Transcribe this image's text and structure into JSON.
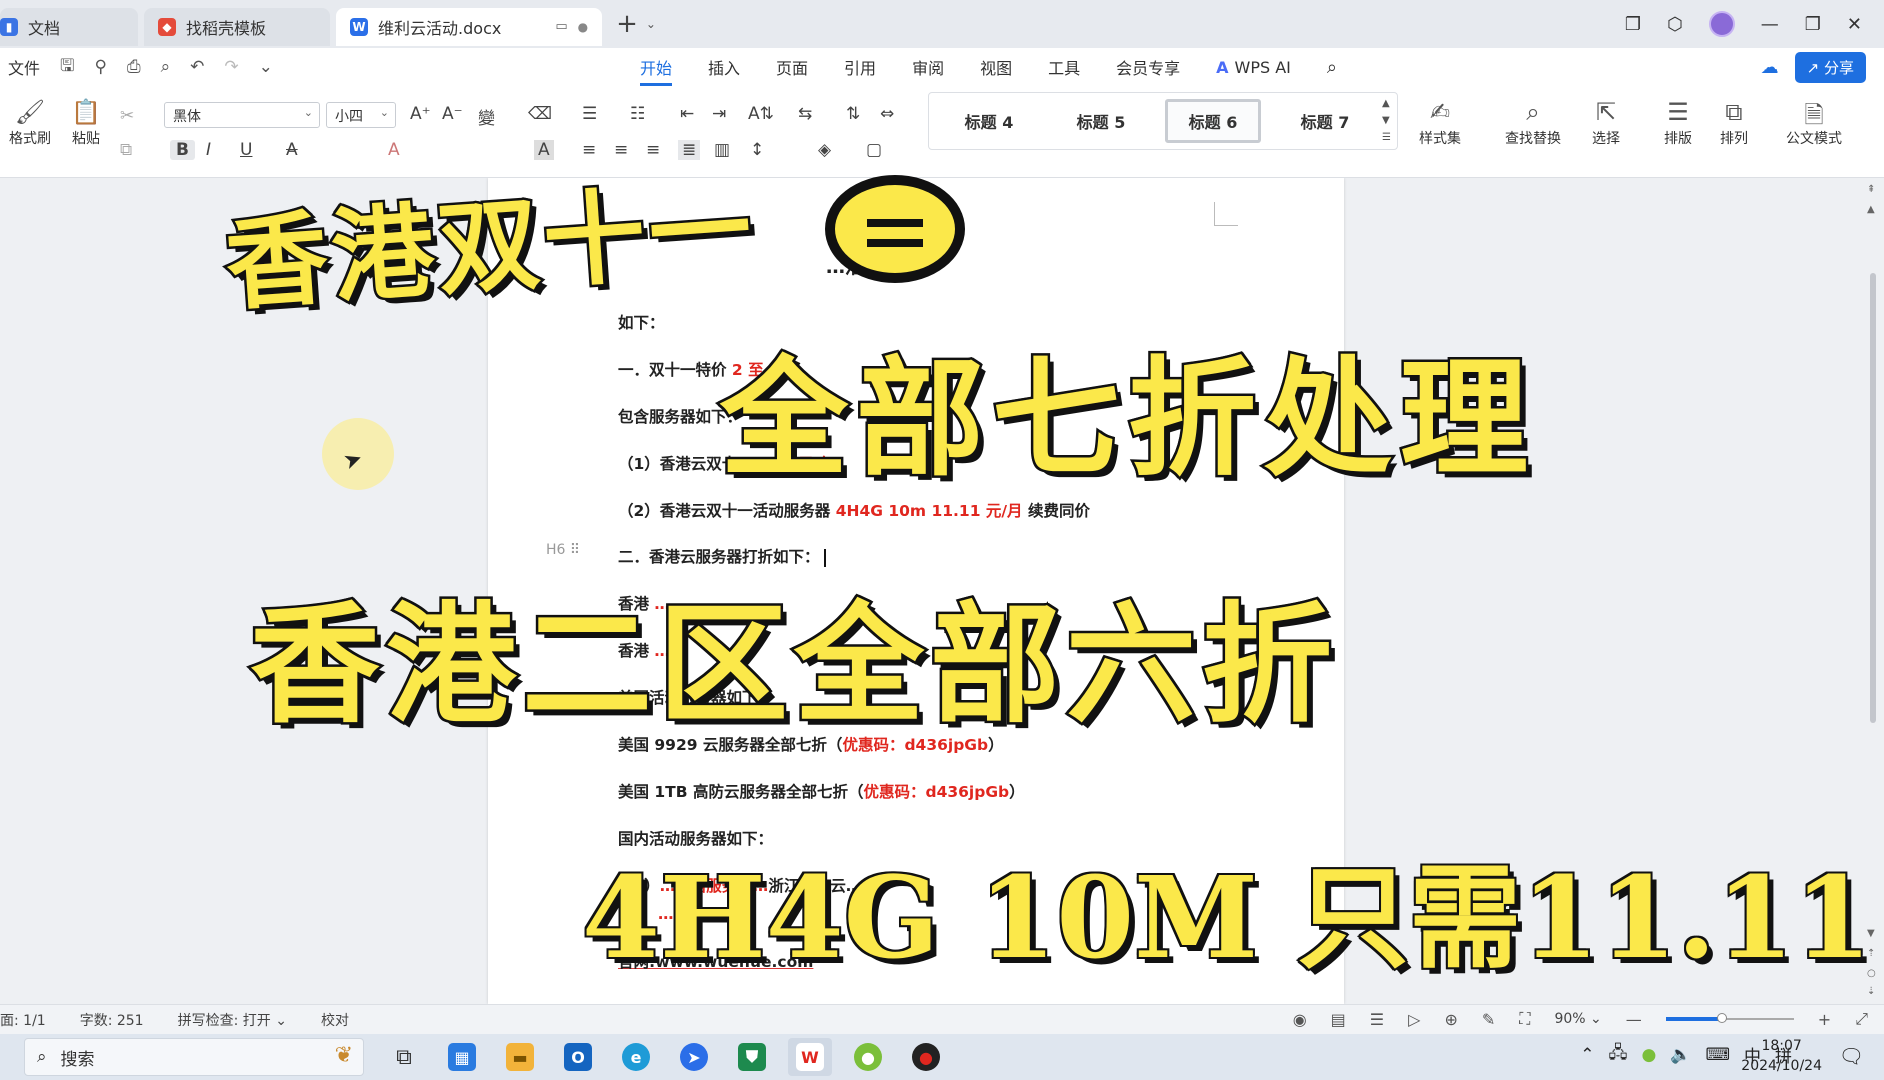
{
  "tabs": [
    {
      "label": "文档",
      "icon": "document-icon",
      "color": "#3b74e4"
    },
    {
      "label": "找稻壳模板",
      "icon": "docer-icon",
      "color": "#e44b3b"
    },
    {
      "label": "维利云活动.docx",
      "icon": "word-icon",
      "color": "#2b6fe8",
      "active": true
    }
  ],
  "menu": {
    "file": "文件",
    "tabs": [
      "开始",
      "插入",
      "页面",
      "引用",
      "审阅",
      "视图",
      "工具",
      "会员专享"
    ],
    "wps_ai": "WPS AI",
    "share": "分享"
  },
  "ribbon": {
    "format_painter": "格式刷",
    "paste": "粘贴",
    "font_name": "黑体",
    "font_size": "小四",
    "styles": [
      "标题 4",
      "标题 5",
      "标题 6",
      "标题 7"
    ],
    "active_style": "标题 6",
    "style_set": "样式集",
    "find_replace": "查找替换",
    "select": "选择",
    "layout": "排版",
    "arrange": "排列",
    "official_mode": "公文模式"
  },
  "document": {
    "title": "…活动",
    "lines": [
      {
        "text": "如下："
      },
      {
        "text": "一．双十一特价",
        "red": "2 至 2"
      },
      {
        "text": "包含服务器如下："
      },
      {
        "text": "（1）香港云双十一",
        "red": "2H2   元/年"
      },
      {
        "text": "（2）香港云双十一活动服务器 ",
        "red": "4H4G 10m   11.11 元/月",
        "tail": " 续费同价"
      },
      {
        "text": "二．香港云服务器打折如下："
      },
      {
        "text": "香港",
        "red": "…"
      },
      {
        "text": "香港",
        "red": "…"
      },
      {
        "text": "美国活动服务器如下："
      },
      {
        "text": "美国 9929 云服务器全部七折（",
        "red": "优惠码：d436jpGb",
        "tail": "）"
      },
      {
        "text": "美国 1TB 高防云服务器全部七折（",
        "red": "优惠码：d436jpGb",
        "tail": "）"
      },
      {
        "text": "国内活动服务器如下："
      },
      {
        "text": "（1）",
        "red": "…电信服务器…",
        "tail": "浙江宁波云…"
      },
      {
        "text": "",
        "red": "…码：d43…"
      },
      {
        "text": "官网:www.wuehue.com"
      }
    ],
    "paragraph_marker": "H6"
  },
  "overlay": {
    "line1": "香港双十一",
    "line2": "全部七折处理",
    "line3": "香港二区全部六折",
    "line4": "4H4G 10M 只需11.11"
  },
  "statusbar": {
    "page": "面: 1/1",
    "word_count": "字数: 251",
    "spell_check": "拼写检查: 打开",
    "proofread": "校对",
    "zoom": "90%",
    "zoom_level": 0.44
  },
  "taskbar": {
    "search_placeholder": "搜索",
    "ime_lang": "中",
    "ime_mode": "拼",
    "time": "18:07",
    "date": "2024/10/24"
  },
  "colors": {
    "accent": "#1e6fe0",
    "overlay_yellow": "#fbe84a",
    "doc_red": "#e0271f"
  }
}
